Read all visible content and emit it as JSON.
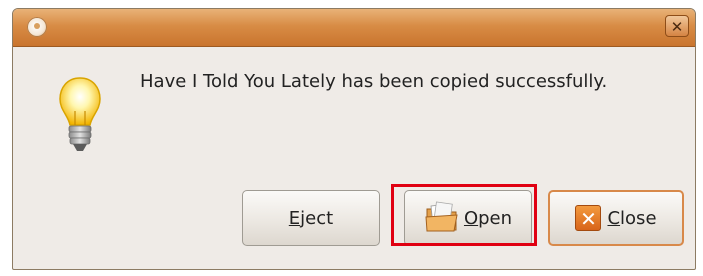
{
  "dialog": {
    "message": "Have I Told You Lately has been copied successfully."
  },
  "titlebar": {
    "close_glyph": "✕"
  },
  "icons": {
    "app": "app-icon",
    "message": "lightbulb-icon",
    "open": "folder-open-icon",
    "close": "close-x-icon"
  },
  "buttons": {
    "eject": {
      "mnemonic": "E",
      "rest": "ject"
    },
    "open": {
      "mnemonic": "O",
      "rest": "pen"
    },
    "close": {
      "mnemonic": "C",
      "rest": "lose",
      "icon_glyph": "✕"
    }
  },
  "colors": {
    "titlebar": "#d88c45",
    "highlight": "#e00012",
    "focus_border": "#d8894a"
  }
}
